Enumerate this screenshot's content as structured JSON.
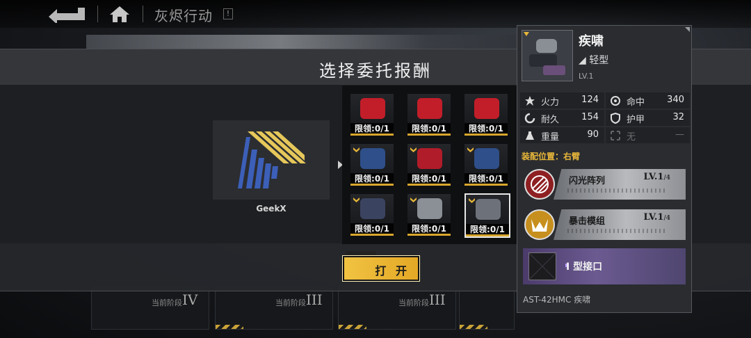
{
  "nav": {
    "title": "灰烬行动",
    "alert": "!"
  },
  "dialog": {
    "title": "选择委托报酬",
    "sponsor_name": "GeekX",
    "open_button": "打 开"
  },
  "rewards": [
    {
      "limit": "限领:0/1",
      "color": "#c21e2a",
      "badge": false,
      "selected": false
    },
    {
      "limit": "限领:0/1",
      "color": "#c21e2a",
      "badge": false,
      "selected": false
    },
    {
      "limit": "限领:0/1",
      "color": "#c21e2a",
      "badge": false,
      "selected": false
    },
    {
      "limit": "限领:0/1",
      "color": "#2f4f8a",
      "badge": true,
      "selected": false
    },
    {
      "limit": "限领:0/1",
      "color": "#b11c2a",
      "badge": true,
      "selected": false
    },
    {
      "limit": "限领:0/1",
      "color": "#2f4f8a",
      "badge": true,
      "selected": false
    },
    {
      "limit": "限领:0/1",
      "color": "#3a4460",
      "badge": true,
      "selected": false
    },
    {
      "limit": "限领:0/1",
      "color": "#8b8f96",
      "badge": true,
      "selected": false
    },
    {
      "limit": "限领:0/1",
      "color": "#6d727a",
      "badge": true,
      "selected": true
    }
  ],
  "stages": [
    {
      "label": "当前阶段",
      "num": "IV"
    },
    {
      "label": "当前阶段",
      "num": "III"
    },
    {
      "label": "当前阶段",
      "num": "III"
    }
  ],
  "tooltip": {
    "name": "疾啸",
    "type": "轻型",
    "level": "LV.1",
    "stats": [
      {
        "name": "火力",
        "value": "124",
        "icon": "firepower-icon"
      },
      {
        "name": "命中",
        "value": "340",
        "icon": "accuracy-icon"
      },
      {
        "name": "耐久",
        "value": "154",
        "icon": "durability-icon"
      },
      {
        "name": "护甲",
        "value": "32",
        "icon": "armor-icon"
      },
      {
        "name": "重量",
        "value": "90",
        "icon": "weight-icon"
      },
      {
        "name": "无",
        "value": "—",
        "icon": "none-icon"
      }
    ],
    "equip_label": "装配位置：",
    "equip_value": "右臂",
    "modules": [
      {
        "name": "闪光阵列",
        "level": "LV.1",
        "max": "/4"
      },
      {
        "name": "暴击模组",
        "level": "LV.1",
        "max": "/4"
      }
    ],
    "interface": "I 型接口",
    "footer": "AST-42HMC 疾啸"
  },
  "colors": {
    "accent": "#e8b73a",
    "interface_purple": "#6b5a90"
  }
}
